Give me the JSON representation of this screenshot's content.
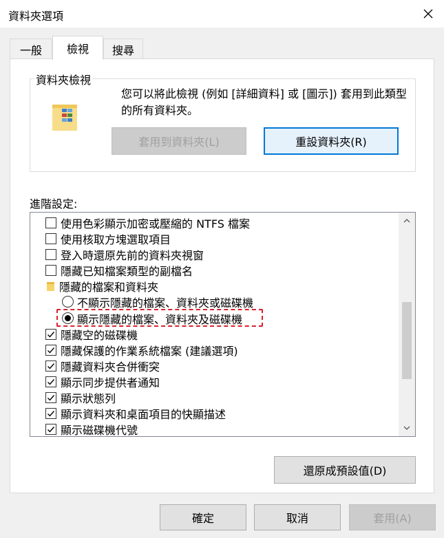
{
  "window": {
    "title": "資料夾選項"
  },
  "tabs": [
    {
      "label": "一般"
    },
    {
      "label": "檢視"
    },
    {
      "label": "搜尋"
    }
  ],
  "folder_views": {
    "legend": "資料夾檢視",
    "description": "您可以將此檢視 (例如 [詳細資料] 或 [圖示]) 套用到此類型的所有資料夾。",
    "apply_button": "套用到資料夾(L)",
    "reset_button": "重設資料夾(R)"
  },
  "advanced": {
    "label": "進階設定:",
    "items": [
      {
        "type": "checkbox",
        "checked": false,
        "label": "使用色彩顯示加密或壓縮的 NTFS 檔案"
      },
      {
        "type": "checkbox",
        "checked": false,
        "label": "使用核取方塊選取項目"
      },
      {
        "type": "checkbox",
        "checked": false,
        "label": "登入時還原先前的資料夾視窗"
      },
      {
        "type": "checkbox",
        "checked": false,
        "label": "隱藏已知檔案類型的副檔名"
      },
      {
        "type": "folder",
        "label": "隱藏的檔案和資料夾"
      },
      {
        "type": "radio",
        "checked": false,
        "label": "不顯示隱藏的檔案、資料夾或磁碟機"
      },
      {
        "type": "radio",
        "checked": true,
        "label": "顯示隱藏的檔案、資料夾及磁碟機"
      },
      {
        "type": "checkbox",
        "checked": true,
        "label": "隱藏空的磁碟機"
      },
      {
        "type": "checkbox",
        "checked": true,
        "label": "隱藏保護的作業系統檔案 (建議選項)"
      },
      {
        "type": "checkbox",
        "checked": true,
        "label": "隱藏資料夾合併衝突"
      },
      {
        "type": "checkbox",
        "checked": true,
        "label": "顯示同步提供者通知"
      },
      {
        "type": "checkbox",
        "checked": true,
        "label": "顯示狀態列"
      },
      {
        "type": "checkbox",
        "checked": true,
        "label": "顯示資料夾和桌面項目的快顯描述"
      },
      {
        "type": "checkbox",
        "checked": true,
        "label": "顯示磁碟機代號"
      }
    ],
    "restore_button": "還原成預設值(D)"
  },
  "footer": {
    "ok": "確定",
    "cancel": "取消",
    "apply": "套用(A)"
  }
}
